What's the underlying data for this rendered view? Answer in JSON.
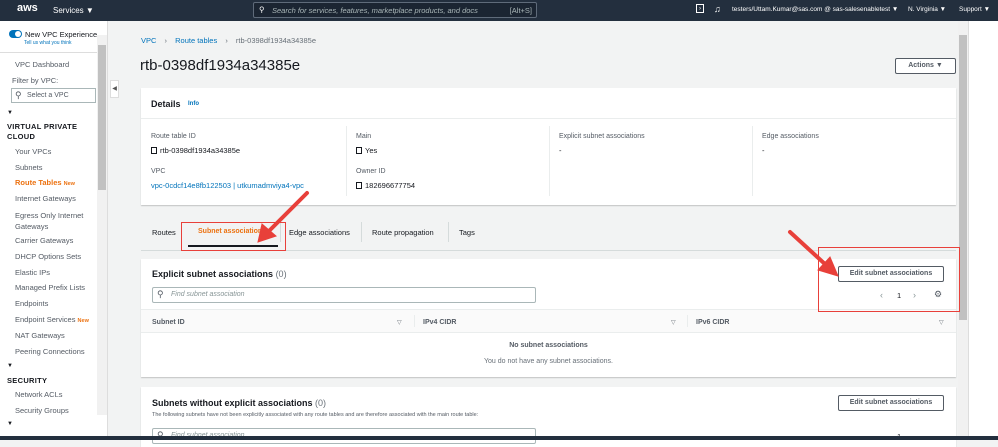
{
  "topbar": {
    "logo": "aws",
    "services": "Services ▼",
    "search_placeholder": "Search for services, features, marketplace products, and docs",
    "search_shortcut": "[Alt+S]",
    "user": "testers/Uttam.Kumar@sas.com @ sas-salesenabletest ▼",
    "region": "N. Virginia ▼",
    "support": "Support ▼"
  },
  "sidebar": {
    "new_experience": "New VPC Experience",
    "feedback": "Tell us what you think",
    "dashboard": "VPC Dashboard",
    "filter_label": "Filter by VPC:",
    "filter_placeholder": "Select a VPC",
    "section_vpc": "VIRTUAL PRIVATE CLOUD",
    "section_security": "SECURITY",
    "new_badge": "New",
    "items": [
      "Your VPCs",
      "Subnets",
      "Route Tables",
      "Internet Gateways",
      "Egress Only Internet Gateways",
      "Carrier Gateways",
      "DHCP Options Sets",
      "Elastic IPs",
      "Managed Prefix Lists",
      "Endpoints",
      "Endpoint Services",
      "NAT Gateways",
      "Peering Connections"
    ],
    "security_items": [
      "Network ACLs",
      "Security Groups"
    ]
  },
  "breadcrumb": [
    "VPC",
    "Route tables",
    "rtb-0398df1934a34385e"
  ],
  "page_title": "rtb-0398df1934a34385e",
  "actions_label": "Actions ▼",
  "details": {
    "title": "Details",
    "info": "Info",
    "route_table_id_label": "Route table ID",
    "route_table_id": "rtb-0398df1934a34385e",
    "vpc_label": "VPC",
    "vpc": "vpc-0cdcf14e8fb122503 | utkumadmviya4-vpc",
    "main_label": "Main",
    "main": "Yes",
    "owner_label": "Owner ID",
    "owner": "182696677754",
    "explicit_label": "Explicit subnet associations",
    "explicit": "-",
    "edge_label": "Edge associations",
    "edge": "-"
  },
  "tabs": [
    "Routes",
    "Subnet associations",
    "Edge associations",
    "Route propagation",
    "Tags"
  ],
  "explicit": {
    "title": "Explicit subnet associations",
    "count": "(0)",
    "edit": "Edit subnet associations",
    "search_placeholder": "Find subnet association",
    "page": "1",
    "columns": [
      "Subnet ID",
      "IPv4 CIDR",
      "IPv6 CIDR"
    ],
    "empty_title": "No subnet associations",
    "empty_desc": "You do not have any subnet associations."
  },
  "without": {
    "title": "Subnets without explicit associations",
    "count": "(0)",
    "edit": "Edit subnet associations",
    "desc": "The following subnets have not been explicitly associated with any route tables and are therefore associated with the main route table:",
    "search_placeholder": "Find subnet association",
    "page": "1"
  }
}
